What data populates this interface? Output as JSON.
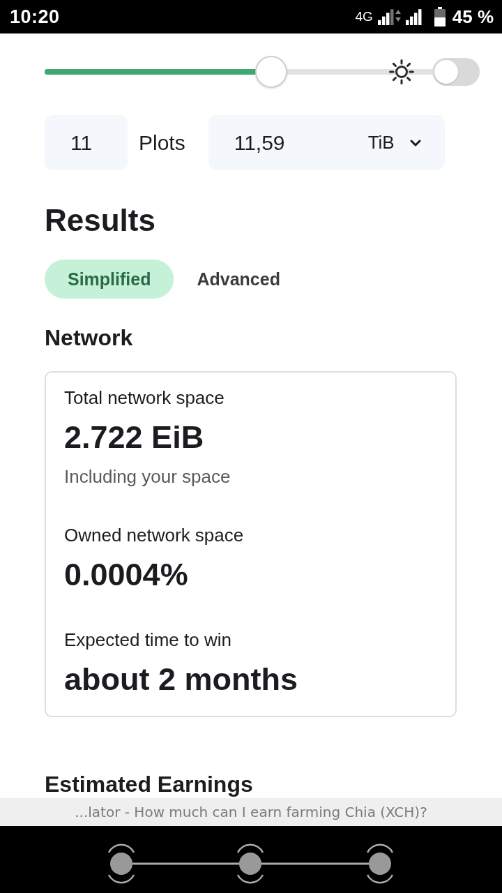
{
  "status_bar": {
    "time": "10:20",
    "network": "4G",
    "battery": "45 %"
  },
  "plot_size_slider": {
    "level": 0.585
  },
  "theme_toggle": {
    "on": false
  },
  "inputs": {
    "plots": {
      "value": "11"
    },
    "plots_label": "Plots",
    "space": {
      "value": "11,59",
      "unit": "TiB"
    }
  },
  "results": {
    "title": "Results",
    "tabs": [
      {
        "label": "Simplified",
        "selected": true
      },
      {
        "label": "Advanced",
        "selected": false
      }
    ]
  },
  "network": {
    "title": "Network",
    "stats": [
      {
        "label": "Total network space",
        "value": "2.722 EiB",
        "note": "Including your space"
      },
      {
        "label": "Owned network space",
        "value": "0.0004%"
      },
      {
        "label": "Expected time to win",
        "value": "about 2 months"
      }
    ]
  },
  "next_section": {
    "title": "Estimated Earnings"
  },
  "page_title_bar": {
    "text": "...lator - How much can I earn farming Chia (XCH)?"
  }
}
